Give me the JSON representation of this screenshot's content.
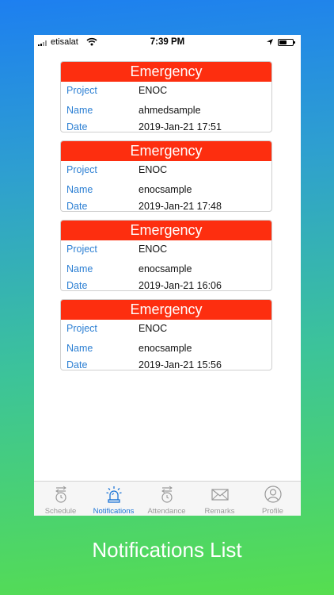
{
  "status_bar": {
    "carrier": "etisalat",
    "time": "7:39 PM"
  },
  "notifications": [
    {
      "title": "Emergency",
      "project_label": "Project",
      "project": "ENOC",
      "name_label": "Name",
      "name": "ahmedsample",
      "date_label": "Date",
      "date": "2019-Jan-21 17:51"
    },
    {
      "title": "Emergency",
      "project_label": "Project",
      "project": "ENOC",
      "name_label": "Name",
      "name": "enocsample",
      "date_label": "Date",
      "date": "2019-Jan-21 17:48"
    },
    {
      "title": "Emergency",
      "project_label": "Project",
      "project": "ENOC",
      "name_label": "Name",
      "name": "enocsample",
      "date_label": "Date",
      "date": "2019-Jan-21 16:06"
    },
    {
      "title": "Emergency",
      "project_label": "Project",
      "project": "ENOC",
      "name_label": "Name",
      "name": "enocsample",
      "date_label": "Date",
      "date": "2019-Jan-21 15:56"
    }
  ],
  "tabs": [
    {
      "label": "Schedule",
      "icon": "clock-icon",
      "active": false
    },
    {
      "label": "Notifications",
      "icon": "alarm-siren-icon",
      "active": true
    },
    {
      "label": "Attendance",
      "icon": "clock-icon",
      "active": false
    },
    {
      "label": "Remarks",
      "icon": "envelope-icon",
      "active": false
    },
    {
      "label": "Profile",
      "icon": "person-icon",
      "active": false
    }
  ],
  "colors": {
    "header_red": "#fd2e0f",
    "label_blue": "#2c7fd3",
    "active_tab": "#1b74d6",
    "inactive_tab": "#9a9a9a"
  },
  "caption": "Notifications List"
}
